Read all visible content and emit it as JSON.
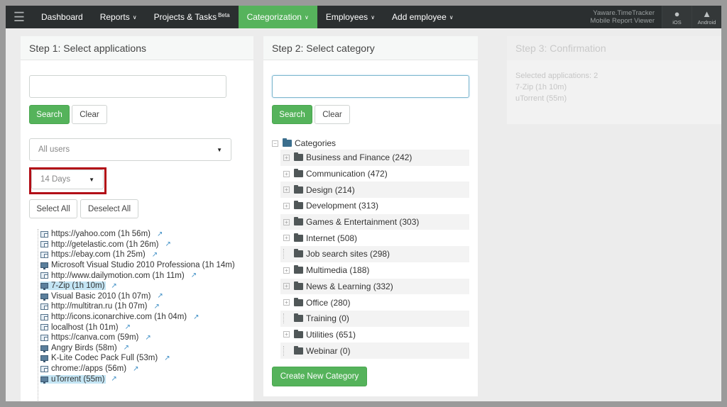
{
  "nav": {
    "items": [
      {
        "label": "Dashboard",
        "caret": false,
        "sup": ""
      },
      {
        "label": "Reports",
        "caret": true,
        "sup": ""
      },
      {
        "label": "Projects & Tasks",
        "caret": false,
        "sup": "Beta"
      },
      {
        "label": "Categorization",
        "caret": true,
        "sup": ""
      },
      {
        "label": "Employees",
        "caret": true,
        "sup": ""
      },
      {
        "label": "Add employee",
        "caret": true,
        "sup": ""
      }
    ],
    "brand_line1": "Yaware.TimeTracker",
    "brand_line2": "Mobile Report Viewer",
    "ios_label": "iOS",
    "android_label": "Android"
  },
  "step1": {
    "title": "Step 1: Select applications",
    "search_label": "Search",
    "clear_label": "Clear",
    "users_value": "All users",
    "period_value": "14 Days",
    "select_all_label": "Select All",
    "deselect_all_label": "Deselect All",
    "apps": [
      {
        "name": "https://yahoo.com (1h 56m)",
        "type": "web",
        "selected": false,
        "link": true
      },
      {
        "name": "http://getelastic.com (1h 26m)",
        "type": "web",
        "selected": false,
        "link": true
      },
      {
        "name": "https://ebay.com (1h 25m)",
        "type": "web",
        "selected": false,
        "link": true
      },
      {
        "name": "Microsoft Visual Studio 2010 Professiona (1h 14m)",
        "type": "desk",
        "selected": false,
        "link": false
      },
      {
        "name": "http://www.dailymotion.com (1h 11m)",
        "type": "web",
        "selected": false,
        "link": true
      },
      {
        "name": "7-Zip (1h 10m)",
        "type": "desk",
        "selected": true,
        "link": true
      },
      {
        "name": "Visual Basic 2010 (1h 07m)",
        "type": "desk",
        "selected": false,
        "link": true
      },
      {
        "name": "http://multitran.ru (1h 07m)",
        "type": "web",
        "selected": false,
        "link": true
      },
      {
        "name": "http://icons.iconarchive.com (1h 04m)",
        "type": "web",
        "selected": false,
        "link": true
      },
      {
        "name": "localhost (1h 01m)",
        "type": "web",
        "selected": false,
        "link": true
      },
      {
        "name": "https://canva.com (59m)",
        "type": "web",
        "selected": false,
        "link": true
      },
      {
        "name": "Angry Birds (58m)",
        "type": "desk",
        "selected": false,
        "link": true
      },
      {
        "name": "K-Lite Codec Pack Full (53m)",
        "type": "desk",
        "selected": false,
        "link": true
      },
      {
        "name": "chrome://apps (56m)",
        "type": "web",
        "selected": false,
        "link": true
      },
      {
        "name": "uTorrent (55m)",
        "type": "desk",
        "selected": true,
        "link": true
      }
    ]
  },
  "step2": {
    "title": "Step 2: Select category",
    "search_label": "Search",
    "clear_label": "Clear",
    "root_label": "Categories",
    "categories": [
      {
        "label": "Business and Finance (242)",
        "expandable": true
      },
      {
        "label": "Communication (472)",
        "expandable": true
      },
      {
        "label": "Design (214)",
        "expandable": true
      },
      {
        "label": "Development (313)",
        "expandable": true
      },
      {
        "label": "Games & Entertainment (303)",
        "expandable": true
      },
      {
        "label": "Internet (508)",
        "expandable": true
      },
      {
        "label": "Job search sites (298)",
        "expandable": false
      },
      {
        "label": "Multimedia (188)",
        "expandable": true
      },
      {
        "label": "News & Learning (332)",
        "expandable": true
      },
      {
        "label": "Office (280)",
        "expandable": true
      },
      {
        "label": "Training (0)",
        "expandable": false
      },
      {
        "label": "Utilities (651)",
        "expandable": true
      },
      {
        "label": "Webinar (0)",
        "expandable": false
      }
    ],
    "create_label": "Create New Category"
  },
  "step3": {
    "title": "Step 3: Confirmation",
    "lines": [
      "Selected applications: 2",
      "7-Zip (1h 10m)",
      "uTorrent (55m)"
    ]
  },
  "colors": {
    "nav_bg": "#2b2f30",
    "accent_green": "#55b35b",
    "highlight_red": "#b20e17",
    "selection_blue": "#c4e5f4"
  }
}
